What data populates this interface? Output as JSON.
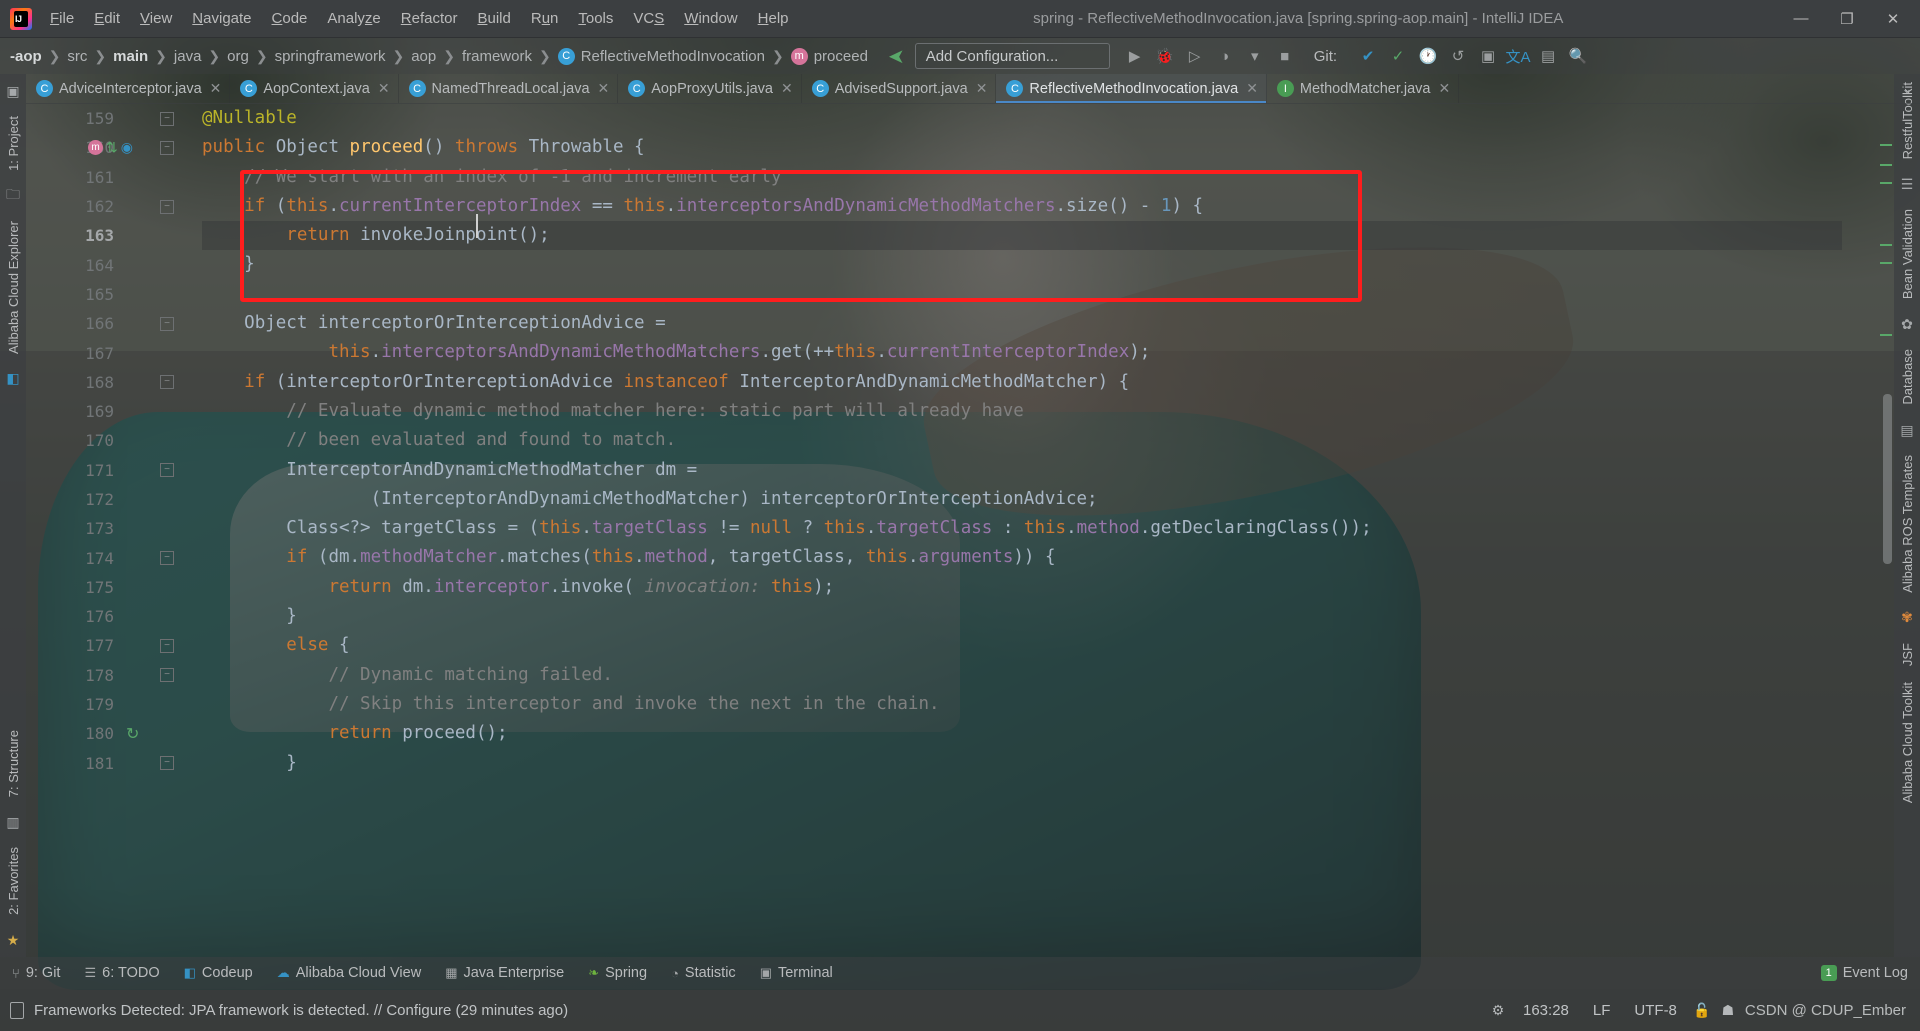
{
  "window": {
    "title": "spring - ReflectiveMethodInvocation.java [spring.spring-aop.main] - IntelliJ IDEA",
    "logo_name": "intellij-idea-logo",
    "minimize": "—",
    "maximize": "❐",
    "close": "✕"
  },
  "menu": [
    {
      "label": "File",
      "mnemonic": "F"
    },
    {
      "label": "Edit",
      "mnemonic": "E"
    },
    {
      "label": "View",
      "mnemonic": "V"
    },
    {
      "label": "Navigate",
      "mnemonic": "N"
    },
    {
      "label": "Code",
      "mnemonic": "C"
    },
    {
      "label": "Analyze",
      "mnemonic": "z"
    },
    {
      "label": "Refactor",
      "mnemonic": "R"
    },
    {
      "label": "Build",
      "mnemonic": "B"
    },
    {
      "label": "Run",
      "mnemonic": "u"
    },
    {
      "label": "Tools",
      "mnemonic": "T"
    },
    {
      "label": "VCS",
      "mnemonic": "S"
    },
    {
      "label": "Window",
      "mnemonic": "W"
    },
    {
      "label": "Help",
      "mnemonic": "H"
    }
  ],
  "breadcrumbs": [
    {
      "label": "-aop",
      "bold": true,
      "icon": ""
    },
    {
      "label": "src",
      "bold": false,
      "icon": ""
    },
    {
      "label": "main",
      "bold": true,
      "icon": ""
    },
    {
      "label": "java",
      "bold": false,
      "icon": ""
    },
    {
      "label": "org",
      "bold": false,
      "icon": ""
    },
    {
      "label": "springframework",
      "bold": false,
      "icon": ""
    },
    {
      "label": "aop",
      "bold": false,
      "icon": ""
    },
    {
      "label": "framework",
      "bold": false,
      "icon": ""
    },
    {
      "label": "ReflectiveMethodInvocation",
      "bold": false,
      "icon": "C"
    },
    {
      "label": "proceed",
      "bold": false,
      "icon": "m"
    }
  ],
  "toolbar": {
    "run_config_label": "Add Configuration...",
    "run_icon": "▶",
    "debug_icon": "🐞",
    "coverage_icon": "▷",
    "profile_icon": "◑",
    "dropdown_icon": "▾",
    "stop_icon": "■",
    "git_label": "Git:",
    "git_update_icon": "✔",
    "git_commit_icon": "✓",
    "git_history_icon": "🕐",
    "git_rollback_icon": "↺",
    "search_icon": "🔍",
    "translate_icon": "文A",
    "run_anything_icon": "▣",
    "structure_icon": "▤"
  },
  "tabs": [
    {
      "label": "AdviceInterceptor.java",
      "icon": "C",
      "active": false
    },
    {
      "label": "AopContext.java",
      "icon": "C",
      "active": false
    },
    {
      "label": "NamedThreadLocal.java",
      "icon": "C",
      "active": false
    },
    {
      "label": "AopProxyUtils.java",
      "icon": "C",
      "active": false
    },
    {
      "label": "AdvisedSupport.java",
      "icon": "C",
      "active": false
    },
    {
      "label": "ReflectiveMethodInvocation.java",
      "icon": "C",
      "active": true
    },
    {
      "label": "MethodMatcher.java",
      "icon": "I",
      "active": false
    }
  ],
  "tabs_overflow_icon": "⌄",
  "left_tool_windows": [
    {
      "label": "1: Project"
    },
    {
      "label": "Alibaba Cloud Explorer"
    },
    {
      "label": "7: Structure"
    },
    {
      "label": "2: Favorites"
    }
  ],
  "right_tool_windows": [
    {
      "label": "RestfulToolkit"
    },
    {
      "label": "Bean Validation"
    },
    {
      "label": "Database"
    },
    {
      "label": "Alibaba ROS Templates"
    },
    {
      "label": "JSF"
    },
    {
      "label": "Alibaba Cloud Toolkit"
    }
  ],
  "editor": {
    "first_line_number": 159,
    "current_line": 163,
    "lines": [
      {
        "n": 159,
        "indent": 0,
        "tokens": [
          {
            "t": "@Nullable",
            "c": "a"
          }
        ]
      },
      {
        "n": 160,
        "indent": 0,
        "tokens": [
          {
            "t": "public ",
            "c": "k"
          },
          {
            "t": "Object ",
            "c": "s"
          },
          {
            "t": "proceed",
            "c": "m"
          },
          {
            "t": "() ",
            "c": "s"
          },
          {
            "t": "throws ",
            "c": "k"
          },
          {
            "t": "Throwable {",
            "c": "s"
          }
        ]
      },
      {
        "n": 161,
        "indent": 1,
        "tokens": [
          {
            "t": "// We start with an index of -1 and increment early",
            "c": "c"
          }
        ]
      },
      {
        "n": 162,
        "indent": 1,
        "tokens": [
          {
            "t": "if ",
            "c": "k"
          },
          {
            "t": "(",
            "c": "s"
          },
          {
            "t": "this",
            "c": "k"
          },
          {
            "t": ".",
            "c": "s"
          },
          {
            "t": "currentInterceptorIndex",
            "c": "f"
          },
          {
            "t": " == ",
            "c": "s"
          },
          {
            "t": "this",
            "c": "k"
          },
          {
            "t": ".",
            "c": "s"
          },
          {
            "t": "interceptorsAndDynamicMethodMatchers",
            "c": "f"
          },
          {
            "t": ".",
            "c": "s"
          },
          {
            "t": "size",
            "c": "s"
          },
          {
            "t": "() - ",
            "c": "s"
          },
          {
            "t": "1",
            "c": "n"
          },
          {
            "t": ") {",
            "c": "s"
          }
        ]
      },
      {
        "n": 163,
        "indent": 2,
        "tokens": [
          {
            "t": "return ",
            "c": "k"
          },
          {
            "t": "invokeJoinpoint",
            "c": "s"
          },
          {
            "t": "();",
            "c": "s"
          }
        ]
      },
      {
        "n": 164,
        "indent": 1,
        "tokens": [
          {
            "t": "}",
            "c": "s"
          }
        ]
      },
      {
        "n": 165,
        "indent": 0,
        "tokens": []
      },
      {
        "n": 166,
        "indent": 1,
        "tokens": [
          {
            "t": "Object ",
            "c": "s"
          },
          {
            "t": "interceptorOrInterceptionAdvice ",
            "c": "s"
          },
          {
            "t": "=",
            "c": "s"
          }
        ]
      },
      {
        "n": 167,
        "indent": 3,
        "tokens": [
          {
            "t": "this",
            "c": "k"
          },
          {
            "t": ".",
            "c": "s"
          },
          {
            "t": "interceptorsAndDynamicMethodMatchers",
            "c": "f"
          },
          {
            "t": ".",
            "c": "s"
          },
          {
            "t": "get(++",
            "c": "s"
          },
          {
            "t": "this",
            "c": "k"
          },
          {
            "t": ".",
            "c": "s"
          },
          {
            "t": "currentInterceptorIndex",
            "c": "f"
          },
          {
            "t": ");",
            "c": "s"
          }
        ]
      },
      {
        "n": 168,
        "indent": 1,
        "tokens": [
          {
            "t": "if ",
            "c": "k"
          },
          {
            "t": "(interceptorOrInterceptionAdvice ",
            "c": "s"
          },
          {
            "t": "instanceof ",
            "c": "k"
          },
          {
            "t": "InterceptorAndDynamicMethodMatcher) {",
            "c": "s"
          }
        ]
      },
      {
        "n": 169,
        "indent": 2,
        "tokens": [
          {
            "t": "// Evaluate dynamic method matcher here: static part will already have",
            "c": "c"
          }
        ]
      },
      {
        "n": 170,
        "indent": 2,
        "tokens": [
          {
            "t": "// been evaluated and found to match.",
            "c": "c"
          }
        ]
      },
      {
        "n": 171,
        "indent": 2,
        "tokens": [
          {
            "t": "InterceptorAndDynamicMethodMatcher ",
            "c": "s"
          },
          {
            "t": "dm ",
            "c": "s"
          },
          {
            "t": "=",
            "c": "s"
          }
        ]
      },
      {
        "n": 172,
        "indent": 4,
        "tokens": [
          {
            "t": "(InterceptorAndDynamicMethodMatcher) interceptorOrInterceptionAdvice;",
            "c": "s"
          }
        ]
      },
      {
        "n": 173,
        "indent": 2,
        "tokens": [
          {
            "t": "Class<?> ",
            "c": "s"
          },
          {
            "t": "targetClass ",
            "c": "s"
          },
          {
            "t": "= (",
            "c": "s"
          },
          {
            "t": "this",
            "c": "k"
          },
          {
            "t": ".",
            "c": "s"
          },
          {
            "t": "targetClass",
            "c": "f"
          },
          {
            "t": " != ",
            "c": "s"
          },
          {
            "t": "null ",
            "c": "k"
          },
          {
            "t": "? ",
            "c": "s"
          },
          {
            "t": "this",
            "c": "k"
          },
          {
            "t": ".",
            "c": "s"
          },
          {
            "t": "targetClass ",
            "c": "f"
          },
          {
            "t": ": ",
            "c": "s"
          },
          {
            "t": "this",
            "c": "k"
          },
          {
            "t": ".",
            "c": "s"
          },
          {
            "t": "method",
            "c": "f"
          },
          {
            "t": ".getDeclaringClass());",
            "c": "s"
          }
        ]
      },
      {
        "n": 174,
        "indent": 2,
        "tokens": [
          {
            "t": "if ",
            "c": "k"
          },
          {
            "t": "(dm.",
            "c": "s"
          },
          {
            "t": "methodMatcher",
            "c": "f"
          },
          {
            "t": ".matches(",
            "c": "s"
          },
          {
            "t": "this",
            "c": "k"
          },
          {
            "t": ".",
            "c": "s"
          },
          {
            "t": "method",
            "c": "f"
          },
          {
            "t": ", targetClass, ",
            "c": "s"
          },
          {
            "t": "this",
            "c": "k"
          },
          {
            "t": ".",
            "c": "s"
          },
          {
            "t": "arguments",
            "c": "f"
          },
          {
            "t": ")) {",
            "c": "s"
          }
        ]
      },
      {
        "n": 175,
        "indent": 3,
        "tokens": [
          {
            "t": "return ",
            "c": "k"
          },
          {
            "t": "dm.",
            "c": "s"
          },
          {
            "t": "interceptor",
            "c": "f"
          },
          {
            "t": ".invoke( ",
            "c": "s"
          },
          {
            "t": "invocation: ",
            "c": "p"
          },
          {
            "t": "this",
            "c": "k"
          },
          {
            "t": ");",
            "c": "s"
          }
        ]
      },
      {
        "n": 176,
        "indent": 2,
        "tokens": [
          {
            "t": "}",
            "c": "s"
          }
        ]
      },
      {
        "n": 177,
        "indent": 2,
        "tokens": [
          {
            "t": "else ",
            "c": "k"
          },
          {
            "t": "{",
            "c": "s"
          }
        ]
      },
      {
        "n": 178,
        "indent": 3,
        "tokens": [
          {
            "t": "// Dynamic matching failed.",
            "c": "c"
          }
        ]
      },
      {
        "n": 179,
        "indent": 3,
        "tokens": [
          {
            "t": "// Skip this interceptor and invoke the next in the chain.",
            "c": "c"
          }
        ]
      },
      {
        "n": 180,
        "indent": 3,
        "tokens": [
          {
            "t": "return ",
            "c": "k"
          },
          {
            "t": "proceed",
            "c": "s"
          },
          {
            "t": "();",
            "c": "s"
          }
        ]
      },
      {
        "n": 181,
        "indent": 2,
        "tokens": [
          {
            "t": "}",
            "c": "s"
          }
        ]
      }
    ],
    "annotation_box_color": "#ff1d1d"
  },
  "bottom_tools": [
    {
      "label": "9: Git",
      "num": "9",
      "icon": "git-branch-icon"
    },
    {
      "label": "6: TODO",
      "num": "6",
      "icon": "todo-icon"
    },
    {
      "label": "Codeup",
      "num": "",
      "icon": "codeup-icon"
    },
    {
      "label": "Alibaba Cloud View",
      "num": "",
      "icon": "cloud-icon"
    },
    {
      "label": "Java Enterprise",
      "num": "",
      "icon": "java-ee-icon"
    },
    {
      "label": "Spring",
      "num": "",
      "icon": "spring-leaf-icon"
    },
    {
      "label": "Statistic",
      "num": "",
      "icon": "statistic-icon"
    },
    {
      "label": "Terminal",
      "num": "",
      "icon": "terminal-icon"
    }
  ],
  "event_log": {
    "label": "Event Log",
    "badge": "1"
  },
  "statusbar": {
    "message": "Frameworks Detected: JPA framework is detected. // Configure (29 minutes ago)",
    "caret_position": "163:28",
    "line_separator": "LF",
    "encoding": "UTF-8",
    "lock_icon": "🔓",
    "inspection_icon": "👤",
    "watermark": "CSDN @ CDUP_Ember",
    "memory_icon": "gear-icon"
  }
}
